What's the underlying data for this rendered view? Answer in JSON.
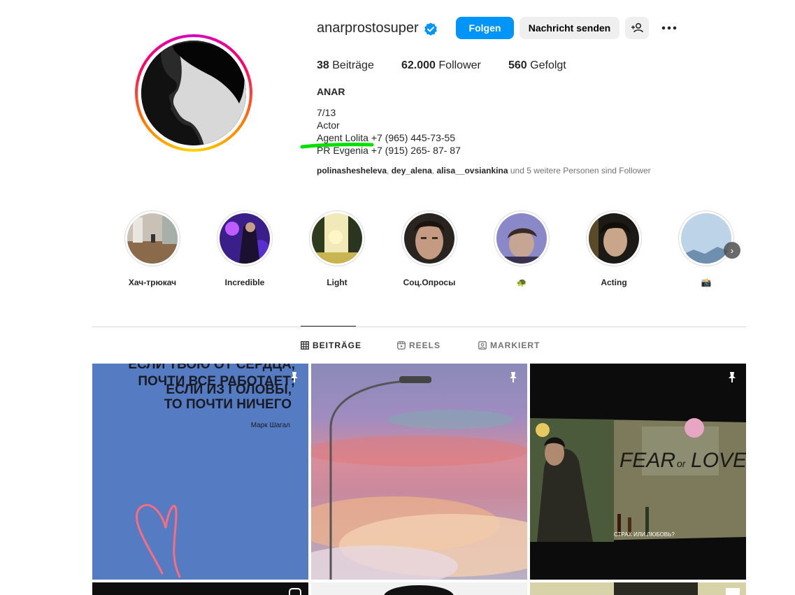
{
  "profile": {
    "username": "anarprostosuper",
    "follow_label": "Folgen",
    "message_label": "Nachricht senden",
    "stats": {
      "posts_count": "38",
      "posts_label": "Beiträge",
      "followers_count": "62.000",
      "followers_label": "Follower",
      "following_count": "560",
      "following_label": "Gefolgt"
    },
    "full_name": "ANAR",
    "bio": [
      "7/13",
      "Actor",
      "Agent Lolita +7 (965) 445-73-55",
      "PR Evgenia +7 (915) 265- 87- 87"
    ],
    "followed_by": {
      "user1": "polinashesheleva",
      "user2": "dey_alena",
      "user3": "alisa__ovsiankina",
      "rest": " und 5 weitere Personen sind Follower"
    }
  },
  "highlights": [
    {
      "label": "Хач-трюкач"
    },
    {
      "label": "Incredible"
    },
    {
      "label": "Light"
    },
    {
      "label": "Соц.Опросы"
    },
    {
      "label": "🐢"
    },
    {
      "label": "Acting"
    },
    {
      "label": "📸"
    }
  ],
  "tabs": {
    "posts": "BEITRÄGE",
    "reels": "REELS",
    "tagged": "MARKIERT"
  },
  "posts": {
    "p1": {
      "line1": "ЕСЛИ ТВОЮ ОТ СЕРДЦА,",
      "line2": "ПОЧТИ ВСЕ РАБОТАЕТ;",
      "line3": "ЕСЛИ ИЗ ГОЛОВЫ,",
      "line4": "ТО ПОЧТИ НИЧЕГО",
      "author": "Марк Шагал"
    },
    "p3": {
      "title_a": "FEAR",
      "title_or": "or",
      "title_b": "LOVE?",
      "subtitle": "СТРАХ ИЛИ ЛЮБОВЬ?"
    }
  },
  "colors": {
    "accent": "#0095f6",
    "verified": "#0095f6",
    "highlight_marker": "#00e000"
  }
}
